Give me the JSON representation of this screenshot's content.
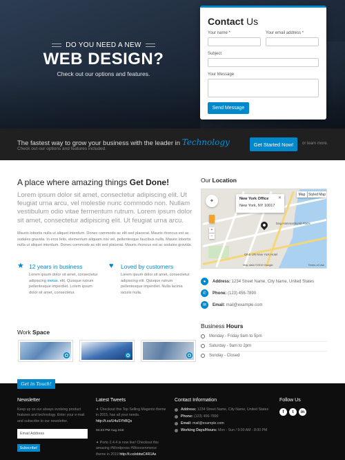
{
  "hero": {
    "kicker": "DO YOU NEED A NEW",
    "title": "WEB DESIGN?",
    "subtitle": "Check out our options and features."
  },
  "contact_form": {
    "title_bold": "Contact",
    "title_rest": " Us",
    "name_label": "Your name *",
    "email_label": "Your email address *",
    "subject_label": "Subject",
    "message_label": "Your Message",
    "submit_label": "Send Message"
  },
  "cta": {
    "line": "The fastest way to grow your business with the leader in ",
    "brand": "Technology",
    "sub": "Check out our options and features included.",
    "button": "Get Started Now!",
    "or_text": "or learn more."
  },
  "main": {
    "title_pre": "A place where amazing things ",
    "title_bold": "Get Done!",
    "lead": "Lorem ipsum dolor sit amet, consectetur adipiscing elit. Ut feugiat urna arcu, vel molestie nunc commodo non. Nullam vestibulum odio vitae fermentum rutrum. Lorem ipsum dolor sit amet, consectetur adipiscing elit. Ut feugiat urna arcu.",
    "paragraph": "Mauris lobortis nulla ut aliquet interdum. Donec commodo ac elit sed placerat. Mauris rhoncus est ac sodales gravida. In eros felis, elementum aliquam nisi vel, pellentesque faucibus nulla. Mauris lobortis nulla ut aliquet interdum. Donec commodo ac elit sed placerat. Mauris rhoncus est ac sodales gravida.",
    "features": [
      {
        "title": "12 years in business",
        "text_a": "Lorem ipsum dolor sit amet, consectetur adipiscing ",
        "link": "metus",
        "text_b": ". elit. Quisque rutrum pellentesque imperdiet. Lorem ipsum dolor sit amet, consectetur."
      },
      {
        "title": "Loved by customers",
        "text_a": "Lorem ipsum dolor sit amet, consectetur adipiscing elit. Quisque rutrum pellentesque imperdiet. Nulla lacinia iaculis nulla.",
        "link": "",
        "text_b": ""
      }
    ],
    "work_title_pre": "Work ",
    "work_title_bold": "Space"
  },
  "location": {
    "title_pre": "Our ",
    "title_bold": "Location",
    "map": {
      "popup_title": "New York Office",
      "popup_sub": "New York, NY 10017",
      "popup_close": "✕",
      "btn_map": "Map",
      "btn_styled": "Styled Map",
      "label_1": "Dag Hammarskjold Plaza",
      "label_2": "ONE UN New York Hotel",
      "copyright": "Map data ©2019 Google",
      "terms": "Terms of Use"
    },
    "address_label": "Address:",
    "address": " 1234 Street Name, City Name, United States",
    "phone_label": "Phone:",
    "phone": " (123) 456-7890",
    "email_label": "Email:",
    "email": " mail@example.com"
  },
  "hours": {
    "title_pre": "Business ",
    "title_bold": "Hours",
    "rows": [
      "Monday - Friday 9am to 5pm",
      "Saturday - 9am to 2pm",
      "Sunday - Closed"
    ]
  },
  "footer": {
    "tab": "Get in Touch!",
    "newsletter": {
      "heading": "Newsletter",
      "text": "Keep up on our always evolving product features and technology. Enter your e-mail and subscribe to our newsletter.",
      "placeholder": "Email Address",
      "button": "Subscribe!"
    },
    "tweets": {
      "heading": "Latest Tweets",
      "tweet1": "Checkout this Top Selling Magento theme in 2015, has all your needs. ",
      "tweet1_link": "http://t.co/U4uSYhBQs",
      "tweet1_date": "04:23 PM Aug 21st",
      "tweet2": "Porto 2.4.4 is now live! Checkout this amazing #Wordpress #Woocommerce theme in 2019 ",
      "tweet2_link": "http://t.co/ebtwC4R1As"
    },
    "contact": {
      "heading": "Contact Information",
      "address_label": "Address:",
      "address": " 1234 Street Name, City Name, United States",
      "phone_label": "Phone:",
      "phone": " (123) 456-7890",
      "email_label": "Email:",
      "email": " mail@example.com",
      "hours_label": "Working Days/Hours:",
      "hours": " Mon - Sun / 9:00 AM - 8:00 PM"
    },
    "follow": {
      "heading": "Follow Us",
      "icons": [
        "f",
        "t",
        "in"
      ]
    }
  },
  "colors": {
    "accent": "#0088cc",
    "dark": "#202020",
    "footer": "#0e0e0e"
  }
}
